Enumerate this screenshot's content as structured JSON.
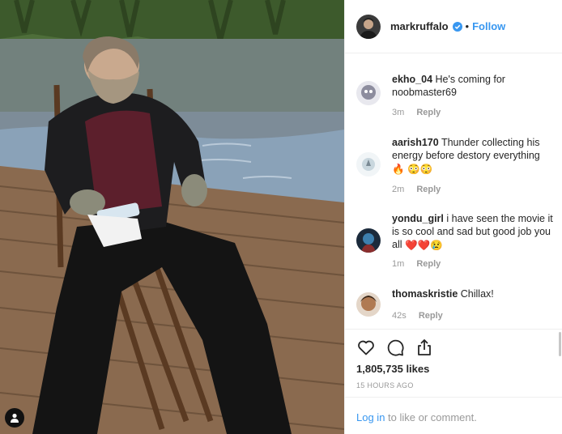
{
  "post": {
    "username": "markruffalo",
    "separator": "•",
    "follow_label": "Follow",
    "icons": {
      "verified": "verified-badge-icon",
      "user_tag": "person-icon",
      "like": "heart-icon",
      "comment": "comment-bubble-icon",
      "share": "share-icon"
    }
  },
  "comments": [
    {
      "user": "ekho_04",
      "text": "He's coming for noobmaster69",
      "emoji": "",
      "age": "3m",
      "reply": "Reply"
    },
    {
      "user": "aarish170",
      "text": "Thunder collecting his energy before destory everything",
      "emoji": "🔥 😳😳",
      "age": "2m",
      "reply": "Reply"
    },
    {
      "user": "yondu_girl",
      "text": "i have seen the movie it is so cool and sad but good job you all",
      "emoji": "❤️❤️😢",
      "age": "1m",
      "reply": "Reply"
    },
    {
      "user": "thomaskristie",
      "text": "Chillax!",
      "emoji": "",
      "age": "42s",
      "reply": "Reply"
    }
  ],
  "stats": {
    "likes": "1,805,735 likes",
    "posted": "15 HOURS AGO"
  },
  "login": {
    "link": "Log in",
    "rest": " to like or comment."
  },
  "colors": {
    "accent": "#3897f0",
    "text": "#262626",
    "muted": "#999999",
    "border": "#efefef",
    "like_heart": "#ed4956"
  }
}
